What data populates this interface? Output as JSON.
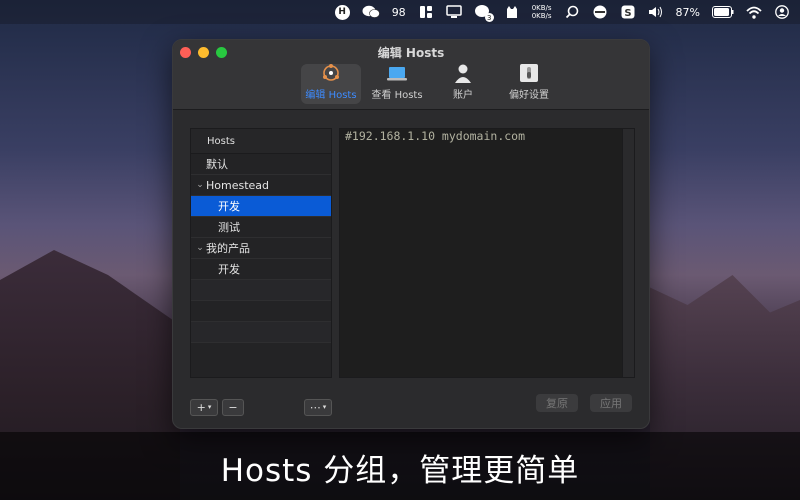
{
  "menubar": {
    "wechat_count": "98",
    "badge_count": "3",
    "net_up": "0KB/s",
    "net_down": "0KB/s",
    "battery": "87%"
  },
  "window": {
    "title": "编辑 Hosts",
    "toolbar": [
      {
        "label": "编辑 Hosts",
        "icon": "edit-hosts-icon",
        "active": true
      },
      {
        "label": "查看 Hosts",
        "icon": "laptop-icon",
        "active": false
      },
      {
        "label": "账户",
        "icon": "user-icon",
        "active": false
      },
      {
        "label": "偏好设置",
        "icon": "switch-icon",
        "active": false
      }
    ]
  },
  "sidebar": {
    "header": "Hosts",
    "rows": [
      {
        "label": "默认"
      },
      {
        "label": "Homestead"
      },
      {
        "label": "开发"
      },
      {
        "label": "测试"
      },
      {
        "label": "我的产品"
      },
      {
        "label": "开发"
      }
    ],
    "footer": {
      "add": "+",
      "remove": "−",
      "more": "⋯"
    }
  },
  "editor": {
    "content": "#192.168.1.10 mydomain.com"
  },
  "actions": {
    "restore": "复原",
    "apply": "应用"
  },
  "caption": "Hosts 分组，管理更简单",
  "colors": {
    "accent": "#3d8bff",
    "selection": "#0a5bd6"
  }
}
